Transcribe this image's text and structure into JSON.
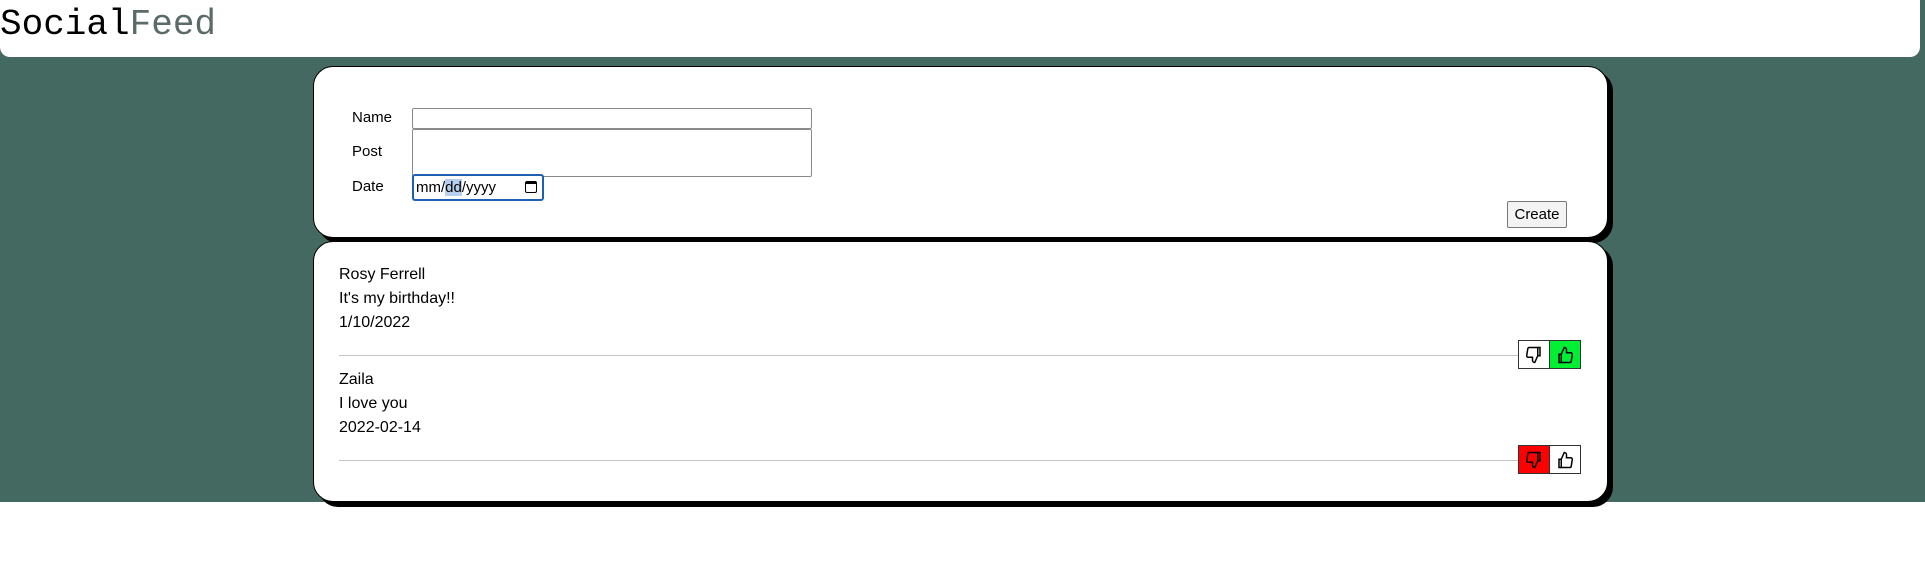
{
  "header": {
    "logo_part1": "Social",
    "logo_part2": "Feed"
  },
  "form": {
    "name_label": "Name",
    "post_label": "Post",
    "date_label": "Date",
    "name_value": "",
    "post_value": "",
    "date_seg_mm": "mm",
    "date_seg_sep1": "/",
    "date_seg_dd": "dd",
    "date_seg_sep2": "/",
    "date_seg_yyyy": "yyyy",
    "create_label": "Create"
  },
  "posts": [
    {
      "name": "Rosy Ferrell",
      "text": "It's my birthday!!",
      "date": "1/10/2022",
      "vote": "up"
    },
    {
      "name": "Zaila",
      "text": "I love you",
      "date": "2022-02-14",
      "vote": "down"
    }
  ],
  "colors": {
    "background_band": "#436961",
    "dislike_active": "#ff0000",
    "like_active": "#00ee33",
    "date_focus": "#1f5fb4"
  }
}
